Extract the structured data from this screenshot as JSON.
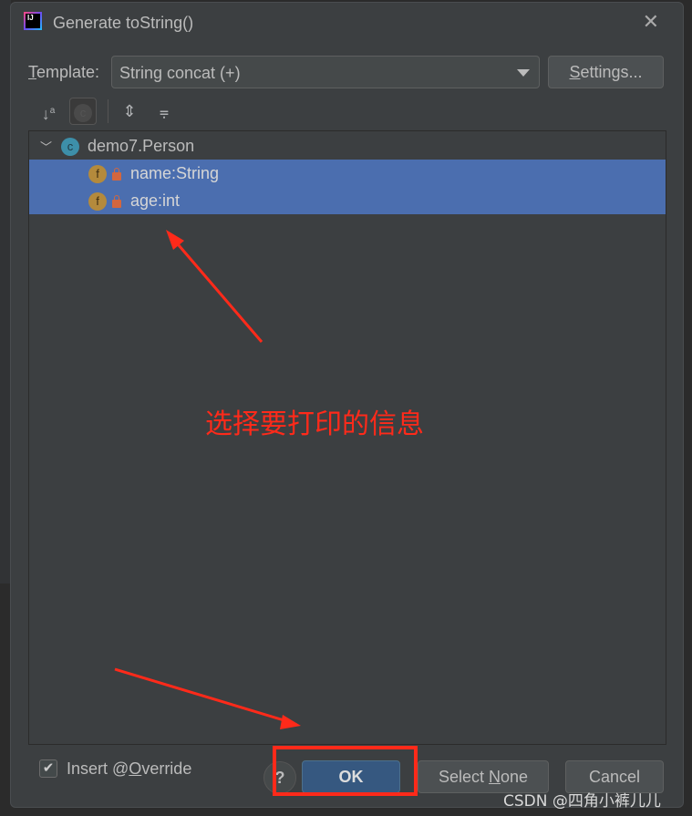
{
  "dialog": {
    "title": "Generate toString()",
    "logo_text": "IJ"
  },
  "template": {
    "label": "Template:",
    "value": "String concat (+)",
    "settings_label": "Settings..."
  },
  "toolbar": {
    "icons": [
      "sort-alpha-icon",
      "show-classes-icon",
      "expand-all-icon",
      "collapse-all-icon"
    ]
  },
  "tree": {
    "class_name": "demo7.Person",
    "fields": [
      {
        "label": "name:String",
        "selected": true
      },
      {
        "label": "age:int",
        "selected": true
      }
    ]
  },
  "footer": {
    "insert_override": "Insert @Override",
    "insert_override_checked": true,
    "help": "?",
    "ok": "OK",
    "select_none": "Select None",
    "cancel": "Cancel"
  },
  "annotation": {
    "text": "选择要打印的信息",
    "color": "#ff2a1a"
  },
  "watermark": "CSDN @四角小裤儿儿",
  "colors": {
    "selection": "#4b6eaf",
    "dialog_bg": "#3c3f41",
    "ok_button": "#365880"
  }
}
